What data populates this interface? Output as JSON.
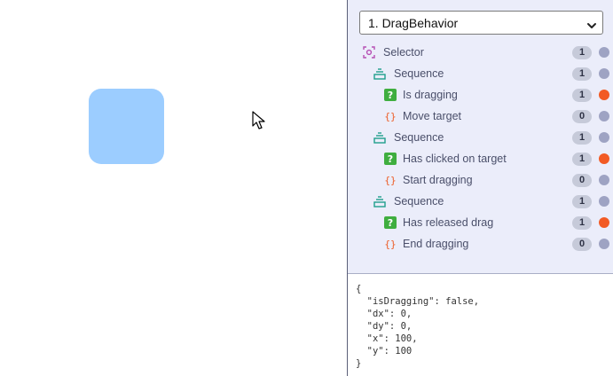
{
  "stage": {
    "target_color": "#9ccdff",
    "cursor_icon": "arrow-cursor-icon"
  },
  "panel": {
    "behavior_select": {
      "value": "1. DragBehavior",
      "options": [
        "1. DragBehavior"
      ]
    },
    "tree": [
      {
        "label": "Selector",
        "kind": "selector",
        "depth": 0,
        "count": "1",
        "status": "idle"
      },
      {
        "label": "Sequence",
        "kind": "sequence",
        "depth": 1,
        "count": "1",
        "status": "idle"
      },
      {
        "label": "Is dragging",
        "kind": "condition",
        "depth": 2,
        "count": "1",
        "status": "failure"
      },
      {
        "label": "Move target",
        "kind": "action",
        "depth": 2,
        "count": "0",
        "status": "idle"
      },
      {
        "label": "Sequence",
        "kind": "sequence",
        "depth": 1,
        "count": "1",
        "status": "idle"
      },
      {
        "label": "Has clicked on target",
        "kind": "condition",
        "depth": 2,
        "count": "1",
        "status": "failure"
      },
      {
        "label": "Start dragging",
        "kind": "action",
        "depth": 2,
        "count": "0",
        "status": "idle"
      },
      {
        "label": "Sequence",
        "kind": "sequence",
        "depth": 1,
        "count": "1",
        "status": "idle"
      },
      {
        "label": "Has released drag",
        "kind": "condition",
        "depth": 2,
        "count": "1",
        "status": "failure"
      },
      {
        "label": "End dragging",
        "kind": "action",
        "depth": 2,
        "count": "0",
        "status": "idle"
      }
    ],
    "blackboard_json": "{\n  \"isDragging\": false,\n  \"dx\": 0,\n  \"dy\": 0,\n  \"x\": 100,\n  \"y\": 100\n}",
    "colors": {
      "selector": "#b64fb3",
      "sequence": "#1e9e8c",
      "condition": "#3fae3f",
      "action": "#ec5b24",
      "failure": "#f25a24",
      "idle": "#9ea3c3"
    }
  }
}
